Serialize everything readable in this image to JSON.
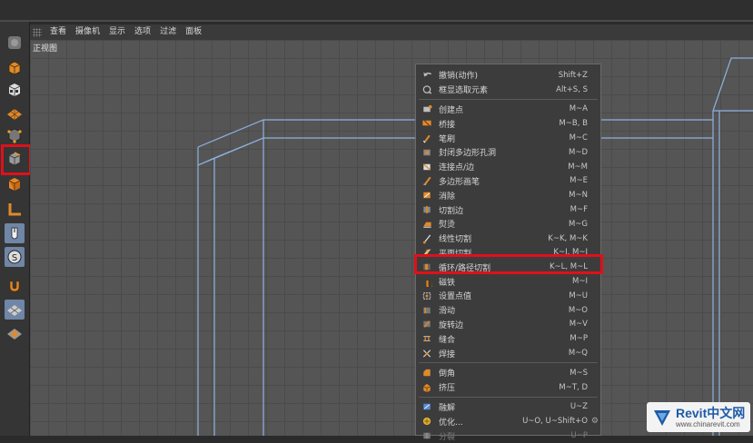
{
  "viewport_menu": [
    "查看",
    "摄像机",
    "显示",
    "选项",
    "过滤",
    "面板"
  ],
  "viewport_label": "正视图",
  "toolbar_left": [
    {
      "icon": "model-mode-icon",
      "selected": false
    },
    {
      "icon": "object-mode-icon",
      "selected": false
    },
    {
      "icon": "texture-mode-icon",
      "selected": false
    },
    {
      "icon": "point-mode-icon",
      "selected": false
    },
    {
      "icon": "edge-mode-icon",
      "selected": false
    },
    {
      "icon": "polygon-mode-icon",
      "selected": false
    },
    {
      "icon": "axis-icon",
      "selected": false
    },
    {
      "icon": "tweak-mode-icon",
      "selected": true
    },
    {
      "icon": "snap-icon",
      "selected": true
    },
    {
      "icon": "magnet-icon",
      "selected": false
    },
    {
      "icon": "workplane-icon",
      "selected": true
    },
    {
      "icon": "lock-workplane-icon",
      "selected": false
    }
  ],
  "context_menu": {
    "groups": [
      [
        {
          "label": "撤销(动作)",
          "shortcut": "Shift+Z",
          "icon": "undo-icon"
        },
        {
          "label": "框显选取元素",
          "shortcut": "Alt+S, S",
          "icon": "frame-selection-icon"
        }
      ],
      [
        {
          "label": "创建点",
          "shortcut": "M~A",
          "icon": "create-point-icon"
        },
        {
          "label": "桥接",
          "shortcut": "M~B, B",
          "icon": "bridge-icon"
        },
        {
          "label": "笔刷",
          "shortcut": "M~C",
          "icon": "brush-icon"
        },
        {
          "label": "封闭多边形孔洞",
          "shortcut": "M~D",
          "icon": "close-hole-icon"
        },
        {
          "label": "连接点/边",
          "shortcut": "M~M",
          "icon": "connect-icon"
        },
        {
          "label": "多边形画笔",
          "shortcut": "M~E",
          "icon": "polygon-pen-icon"
        },
        {
          "label": "消除",
          "shortcut": "M~N",
          "icon": "dissolve-icon"
        },
        {
          "label": "切割边",
          "shortcut": "M~F",
          "icon": "edge-cut-icon"
        },
        {
          "label": "熨烫",
          "shortcut": "M~G",
          "icon": "iron-icon"
        },
        {
          "label": "线性切割",
          "shortcut": "K~K, M~K",
          "icon": "line-cut-icon"
        },
        {
          "label": "平面切割",
          "shortcut": "K~J, M~J",
          "icon": "plane-cut-icon"
        },
        {
          "label": "循环/路径切割",
          "shortcut": "K~L, M~L",
          "icon": "loop-cut-icon"
        },
        {
          "label": "磁铁",
          "shortcut": "M~I",
          "icon": "magnet-icon"
        },
        {
          "label": "设置点值",
          "shortcut": "M~U",
          "icon": "set-point-value-icon"
        },
        {
          "label": "滑动",
          "shortcut": "M~O",
          "icon": "slide-icon"
        },
        {
          "label": "旋转边",
          "shortcut": "M~V",
          "icon": "spin-edge-icon"
        },
        {
          "label": "缝合",
          "shortcut": "M~P",
          "icon": "stitch-icon"
        },
        {
          "label": "焊接",
          "shortcut": "M~Q",
          "icon": "weld-icon"
        }
      ],
      [
        {
          "label": "倒角",
          "shortcut": "M~S",
          "icon": "bevel-icon"
        },
        {
          "label": "挤压",
          "shortcut": "M~T, D",
          "icon": "extrude-icon"
        }
      ],
      [
        {
          "label": "融解",
          "shortcut": "U~Z",
          "icon": "melt-icon"
        },
        {
          "label": "优化...",
          "shortcut": "U~O, U~Shift+O",
          "icon": "optimize-icon",
          "has_options": true,
          "options_icon": "gear-icon"
        },
        {
          "label": "分裂",
          "shortcut": "U~P",
          "icon": "split-icon",
          "disabled": true
        }
      ]
    ],
    "highlighted_item": "循环/路径切割"
  },
  "watermark": {
    "brand": "Revit中文网",
    "url": "www.chinarevit.com"
  },
  "colors": {
    "highlight_box": "#e0101a",
    "wireframe": "#8fb1e0",
    "selected_tool": "#6f86a6",
    "menu_bg": "#3c3c3c",
    "viewport_bg": "#555555"
  }
}
